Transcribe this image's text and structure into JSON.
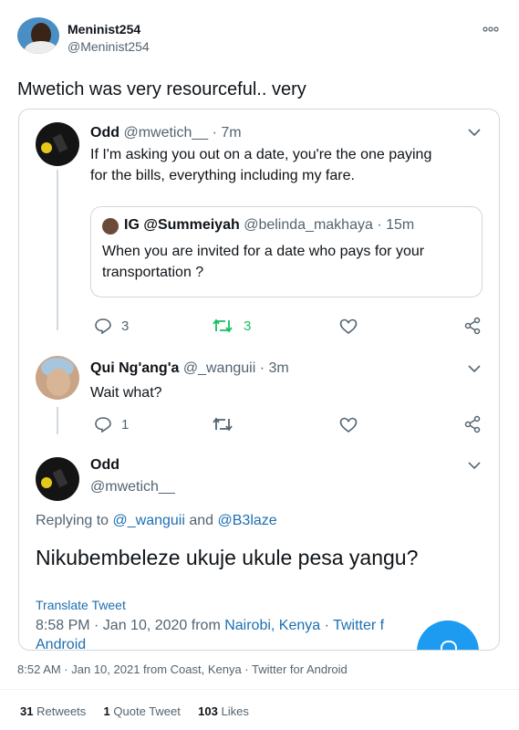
{
  "outer": {
    "name": "Meninist254",
    "handle": "@Meninist254",
    "text": "Mwetich was very resourceful.. very",
    "timestamp": "8:52 AM · Jan 10, 2021 from Coast, Kenya · Twitter for Android",
    "stats": {
      "retweets_count": "31",
      "retweets_label": "Retweets",
      "quotes_count": "1",
      "quotes_label": "Quote Tweet",
      "likes_count": "103",
      "likes_label": "Likes"
    },
    "menu_icon": "more-dots-icon"
  },
  "thread": {
    "tweet1": {
      "name": "Odd",
      "handle": "@mwetich__",
      "time": "· 7m",
      "text_line1": "If I'm asking you out on a date, you're the one paying",
      "text_line2": "for the bills, everything including my fare.",
      "quoted": {
        "name": "IG @Summeiyah",
        "handle": "@belinda_makhaya",
        "time": "· 15m",
        "text_line1": "When you are invited for a date who pays for your",
        "text_line2": "transportation ?"
      },
      "replies": "3",
      "retweets": "3"
    },
    "tweet2": {
      "name": "Qui Ng'ang'a",
      "handle": "@_wanguii",
      "time": "· 3m",
      "text": "Wait what?",
      "replies": "1"
    },
    "tweet3": {
      "name": "Odd",
      "handle": "@mwetich__",
      "replying_prefix": "Replying to",
      "replying_user1": "@_wanguii",
      "replying_and": "and",
      "replying_user2": "@B3laze",
      "text": "Nikubembeleze ukuje ukule pesa yangu?",
      "translate": "Translate Tweet",
      "meta_time": "8:58 PM · Jan 10, 2020 from ",
      "meta_place": "Nairobi, Kenya",
      "meta_sep": " · ",
      "meta_client": "Twitter f",
      "meta_client_line2": "Android"
    }
  },
  "colors": {
    "accent": "#1d9bf0",
    "retweet_green": "#17bf63",
    "link_blue": "#1d6fb0"
  }
}
